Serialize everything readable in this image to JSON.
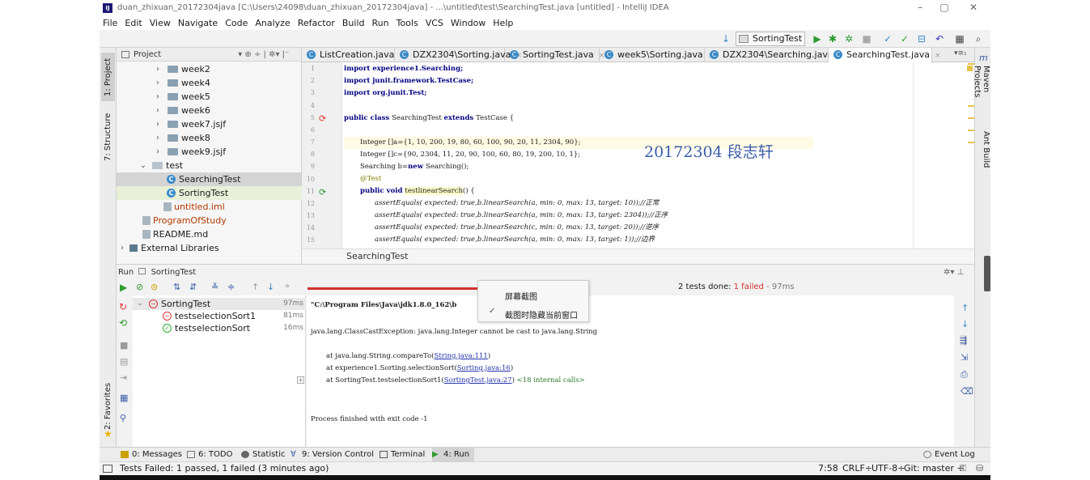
{
  "window": {
    "title": "duan_zhixuan_20172304java [C:\\Users\\24098\\duan_zhixuan_20172304java] - ...\\untitled\\test\\SearchingTest.java [untitled] - IntelliJ IDEA",
    "minimize": "–",
    "maximize": "▢",
    "close": "✕"
  },
  "menu": [
    "File",
    "Edit",
    "View",
    "Navigate",
    "Code",
    "Analyze",
    "Refactor",
    "Build",
    "Run",
    "Tools",
    "VCS",
    "Window",
    "Help"
  ],
  "toolbar": {
    "run_config": "SortingTest"
  },
  "left_strip": {
    "project": "1: Project",
    "structure": "7: Structure",
    "favorites": "2: Favorites"
  },
  "right_strip": {
    "maven": "Maven Projects",
    "ant": "Ant Build",
    "m": "m"
  },
  "project": {
    "header": "Project",
    "items": [
      {
        "label": "week2",
        "kind": "folder",
        "level": 1
      },
      {
        "label": "week4",
        "kind": "folder",
        "level": 1
      },
      {
        "label": "week5",
        "kind": "folder",
        "level": 1
      },
      {
        "label": "week6",
        "kind": "folder",
        "level": 1
      },
      {
        "label": "week7.jsjf",
        "kind": "folder",
        "level": 1
      },
      {
        "label": "week8",
        "kind": "folder",
        "level": 1
      },
      {
        "label": "week9.jsjf",
        "kind": "folder",
        "level": 1
      },
      {
        "label": "test",
        "kind": "folder-open",
        "level": 0
      },
      {
        "label": "SearchingTest",
        "kind": "class",
        "level": 2
      },
      {
        "label": "SortingTest",
        "kind": "class",
        "level": 2
      },
      {
        "label": "untitled.iml",
        "kind": "file",
        "level": 1
      },
      {
        "label": "ProgramOfStudy",
        "kind": "file",
        "level": 0
      },
      {
        "label": "README.md",
        "kind": "file",
        "level": 0
      },
      {
        "label": "External Libraries",
        "kind": "lib",
        "level": -1
      }
    ]
  },
  "tabs": [
    {
      "label": "ListCreation.java"
    },
    {
      "label": "DZX2304\\Sorting.java"
    },
    {
      "label": "SortingTest.java"
    },
    {
      "label": "week5\\Sorting.java"
    },
    {
      "label": "DZX2304\\Searching.java"
    },
    {
      "label": "SearchingTest.java"
    }
  ],
  "tab_close": "×",
  "tabs_overflow": "▾≡₁",
  "editor": {
    "line_numbers": [
      "1",
      "2",
      "3",
      "4",
      "5",
      "6",
      "7",
      "8",
      "9",
      "10",
      "11",
      "12",
      "13",
      "14",
      "15"
    ],
    "lines": {
      "l1": "import experience1.Searching;",
      "l2": "import junit.framework.TestCase;",
      "l3": "import org.junit.Test;",
      "l5a": "public class ",
      "l5b": "SearchingTest ",
      "l5c": "extends ",
      "l5d": "TestCase {",
      "l7": "Integer []a={1, 10, 200, 19, 80, 60, 100, 90, 20, 11, 2304, 90};",
      "l8": "Integer []c={90, 2304, 11, 20, 90, 100, 60, 80, 19, 200, 10, 1};",
      "l9a": "Searching b=",
      "l9b": "new ",
      "l9c": "Searching();",
      "l10": "@Test",
      "l11a": "public void ",
      "l11b": "testlinearSearch",
      "l11c": "() {",
      "l12": "assertEquals( expected: true,b.linearSearch(a,  min: 0,  max: 13,  target: 10));//正常",
      "l13": "assertEquals( expected: true,b.linearSearch(a,  min: 0,  max: 13,  target: 2304));//正序",
      "l14": "assertEquals( expected: true,b.linearSearch(c,  min: 0,  max: 13,  target: 20));//逆序",
      "l15": "assertEquals( expected: true,b.linearSearch(a,  min: 0,  max: 13,  target: 1));//边界"
    },
    "watermark": "20172304  段志轩",
    "breadcrumb": "SearchingTest"
  },
  "run": {
    "header_prefix": "Run",
    "header_config": "SortingTest",
    "summary_prefix": "2 tests done: ",
    "summary_failed": "1 failed",
    "summary_suffix": " - 97ms",
    "tree": [
      {
        "label": "SortingTest",
        "time": "97ms",
        "status": "fail"
      },
      {
        "label": "testselectionSort1",
        "time": "81ms",
        "status": "fail"
      },
      {
        "label": "testselectionSort",
        "time": "16ms",
        "status": "pass"
      }
    ],
    "console": {
      "cmd": "\"C:\\Program Files\\Java\\jdk1.8.0_162\\b",
      "exc": "java.lang.ClassCastException: java.lang.Integer cannot be cast to java.lang.String",
      "at1a": "at java.lang.String.compareTo(",
      "at1b": "String.java:111",
      "at2a": "at experience1.Sorting.selectionSort(",
      "at2b": "Sorting.java:16",
      "at3a": "at SortingTest.testselectionSort1(",
      "at3b": "SortingTest.java:27",
      "at3c": "<18 internal calls>",
      "finish": "Process finished with exit code -1",
      "paren": ")"
    }
  },
  "context_menu": {
    "item1": "屏幕截图",
    "item2": "截图时隐藏当前窗口"
  },
  "bottom_tabs": [
    "0: Messages",
    "6: TODO",
    "Statistic",
    "9: Version Control",
    "Terminal",
    "4: Run"
  ],
  "event_log": "Event Log",
  "status": {
    "message": "Tests Failed: 1 passed, 1 failed (3 minutes ago)",
    "position": "7:58",
    "line_sep": "CRLF÷",
    "encoding": "UTF-8÷",
    "git": "Git: master ÷"
  },
  "colors": {
    "fail": "#d32f2f",
    "pass": "#3a3",
    "accent": "#3b8ac7"
  }
}
